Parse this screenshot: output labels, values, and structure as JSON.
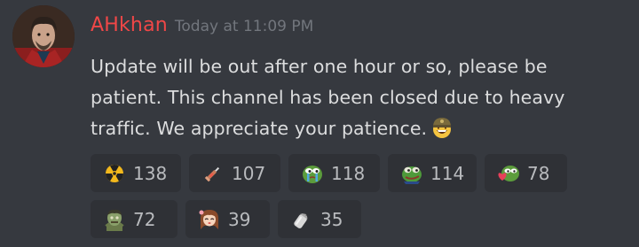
{
  "message": {
    "username": "AHkhan",
    "timestamp": "Today at 11:09 PM",
    "lines": [
      "Update will be out after one hour or so, please be",
      "patient. This channel has been closed due to heavy",
      "traffic. We appreciate your patience."
    ],
    "inline_emoji": "grinning-helmet-emoji",
    "username_color": "#f04747"
  },
  "reactions": [
    {
      "emoji": "radioactive-emoji",
      "count": "138"
    },
    {
      "emoji": "syringe-emoji",
      "count": "107"
    },
    {
      "emoji": "crying-pepe-emoji",
      "count": "118"
    },
    {
      "emoji": "pepe-frog-emoji",
      "count": "114"
    },
    {
      "emoji": "pepe-heart-emoji",
      "count": "78"
    },
    {
      "emoji": "zombie-emoji",
      "count": "72"
    },
    {
      "emoji": "anime-girl-emoji",
      "count": "39"
    },
    {
      "emoji": "salt-shaker-emoji",
      "count": "35"
    }
  ]
}
